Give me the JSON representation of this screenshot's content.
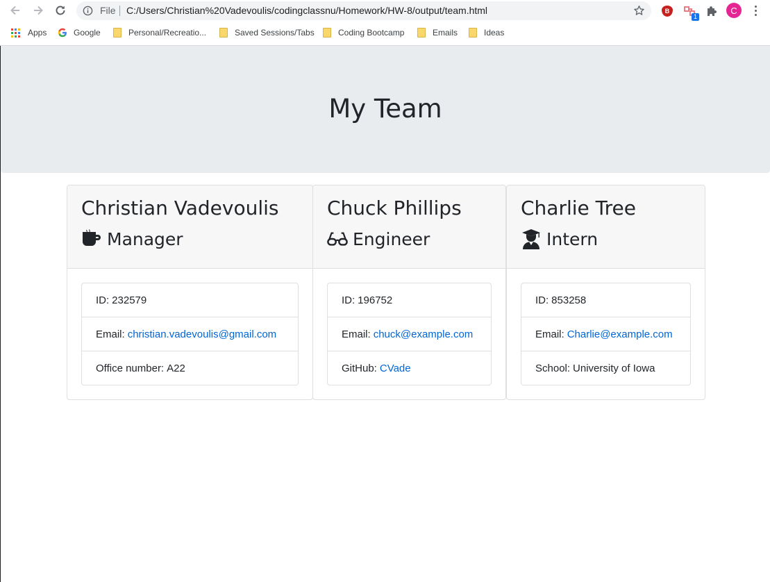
{
  "browser": {
    "omnibox": {
      "scheme_label": "File",
      "url": "C:/Users/Christian%20Vadevoulis/codingclassnu/Homework/HW-8/output/team.html"
    },
    "extensions": {
      "bitwarden_letter": "B",
      "badge_count": "1"
    },
    "profile_initial": "C",
    "bookmarks": [
      {
        "label": "Apps",
        "icon": "apps-grid-icon"
      },
      {
        "label": "Google",
        "icon": "google-icon"
      },
      {
        "label": "Personal/Recreatio...",
        "icon": "folder-icon"
      },
      {
        "label": "Saved Sessions/Tabs",
        "icon": "folder-icon"
      },
      {
        "label": "Coding Bootcamp",
        "icon": "folder-icon"
      },
      {
        "label": "Emails",
        "icon": "folder-icon"
      },
      {
        "label": "Ideas",
        "icon": "folder-icon"
      }
    ]
  },
  "page": {
    "title": "My Team",
    "team": [
      {
        "name": "Christian Vadevoulis",
        "role": "Manager",
        "role_icon": "mug-icon",
        "id_label": "ID:",
        "id": "232579",
        "email_label": "Email:",
        "email": "christian.vadevoulis@gmail.com",
        "extra_label": "Office number:",
        "extra_value": "A22"
      },
      {
        "name": "Chuck Phillips",
        "role": "Engineer",
        "role_icon": "glasses-icon",
        "id_label": "ID:",
        "id": "196752",
        "email_label": "Email:",
        "email": "chuck@example.com",
        "extra_label": "GitHub:",
        "extra_value": "CVade"
      },
      {
        "name": "Charlie Tree",
        "role": "Intern",
        "role_icon": "graduate-icon",
        "id_label": "ID:",
        "id": "853258",
        "email_label": "Email:",
        "email": "Charlie@example.com",
        "extra_label": "School:",
        "extra_value": "University of Iowa"
      }
    ]
  },
  "colors": {
    "jumbotron_bg": "#e9ecef",
    "link": "#0066d6",
    "card_header_bg": "#f7f7f7",
    "text": "#212529"
  }
}
